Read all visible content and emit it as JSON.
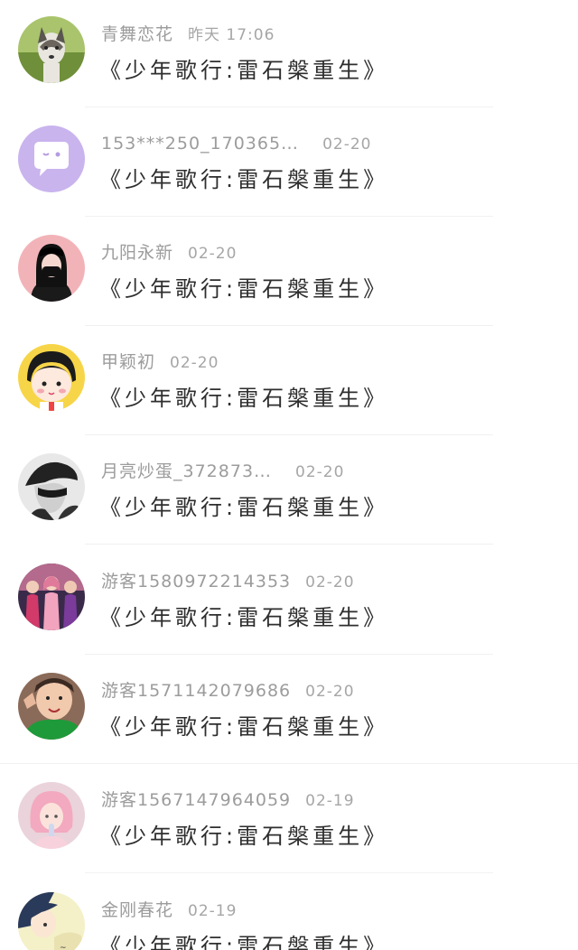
{
  "comments": [
    {
      "name": "青舞恋花",
      "time": "昨天 17:06",
      "text": "《少年歌行:雷石槃重生》",
      "avatar": "husky-dog-avatar"
    },
    {
      "name": "153***250_170365…",
      "time": "02-20",
      "text": "《少年歌行:雷石槃重生》",
      "avatar": "chat-bubble-avatar"
    },
    {
      "name": "九阳永新",
      "time": "02-20",
      "text": "《少年歌行:雷石槃重生》",
      "avatar": "masked-girl-avatar"
    },
    {
      "name": "甲颖初",
      "time": "02-20",
      "text": "《少年歌行:雷石槃重生》",
      "avatar": "cartoon-girl-avatar"
    },
    {
      "name": "月亮炒蛋_372873…",
      "time": "02-20",
      "text": "《少年歌行:雷石槃重生》",
      "avatar": "dark-hat-avatar"
    },
    {
      "name": "游客1580972214353",
      "time": "02-20",
      "text": "《少年歌行:雷石槃重生》",
      "avatar": "group-photo-avatar"
    },
    {
      "name": "游客1571142079686",
      "time": "02-20",
      "text": "《少年歌行:雷石槃重生》",
      "avatar": "child-photo-avatar"
    },
    {
      "name": "游客1567147964059",
      "time": "02-19",
      "text": "《少年歌行:雷石槃重生》",
      "avatar": "pink-hair-avatar"
    },
    {
      "name": "金刚春花",
      "time": "02-19",
      "text": "《少年歌行:雷石槃重生》",
      "avatar": "anime-boy-avatar"
    }
  ],
  "colors": {
    "name_text": "#9c9c9c",
    "time_text": "#a6a6a6",
    "content_text": "#2e2e2e",
    "divider": "#f1f1f1",
    "background": "#ffffff"
  }
}
